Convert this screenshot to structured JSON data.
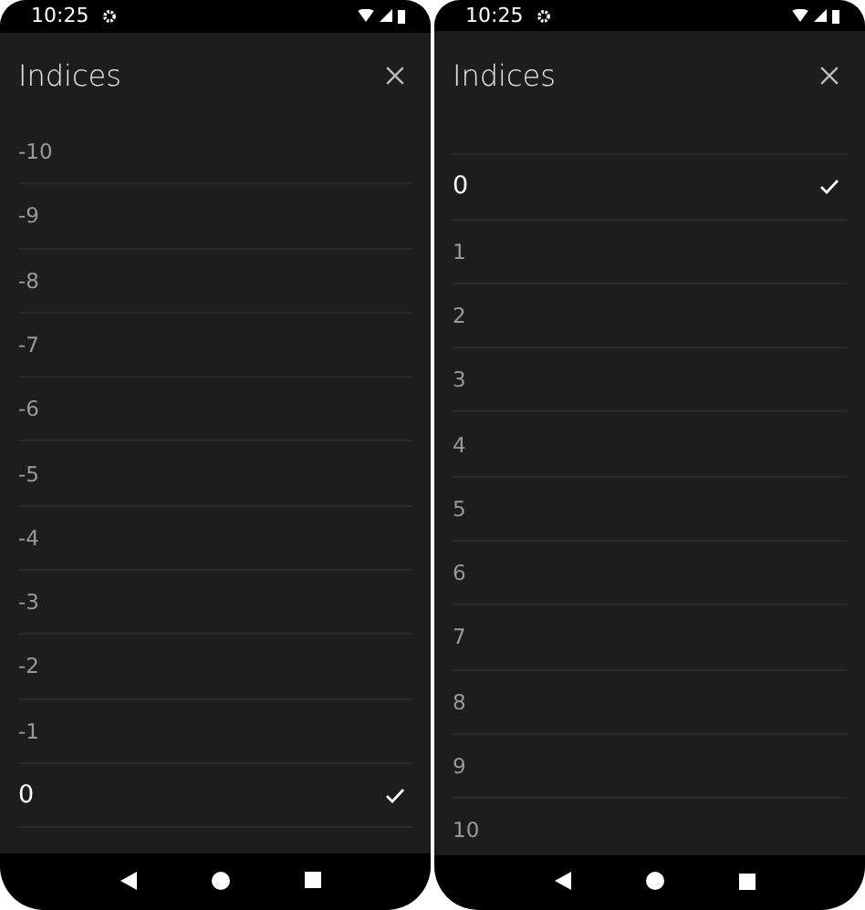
{
  "screens": [
    {
      "time": "10:25",
      "title": "Indices",
      "offset": false,
      "items": [
        {
          "label": "-10",
          "selected": false
        },
        {
          "label": "-9",
          "selected": false
        },
        {
          "label": "-8",
          "selected": false
        },
        {
          "label": "-7",
          "selected": false
        },
        {
          "label": "-6",
          "selected": false
        },
        {
          "label": "-5",
          "selected": false
        },
        {
          "label": "-4",
          "selected": false
        },
        {
          "label": "-3",
          "selected": false
        },
        {
          "label": "-2",
          "selected": false
        },
        {
          "label": "-1",
          "selected": false
        },
        {
          "label": "0",
          "selected": true
        }
      ]
    },
    {
      "time": "10:25",
      "title": "Indices",
      "offset": true,
      "items": [
        {
          "label": "0",
          "selected": true
        },
        {
          "label": "1",
          "selected": false
        },
        {
          "label": "2",
          "selected": false
        },
        {
          "label": "3",
          "selected": false
        },
        {
          "label": "4",
          "selected": false
        },
        {
          "label": "5",
          "selected": false
        },
        {
          "label": "6",
          "selected": false
        },
        {
          "label": "7",
          "selected": false
        },
        {
          "label": "8",
          "selected": false
        },
        {
          "label": "9",
          "selected": false
        },
        {
          "label": "10",
          "selected": false
        }
      ]
    }
  ]
}
